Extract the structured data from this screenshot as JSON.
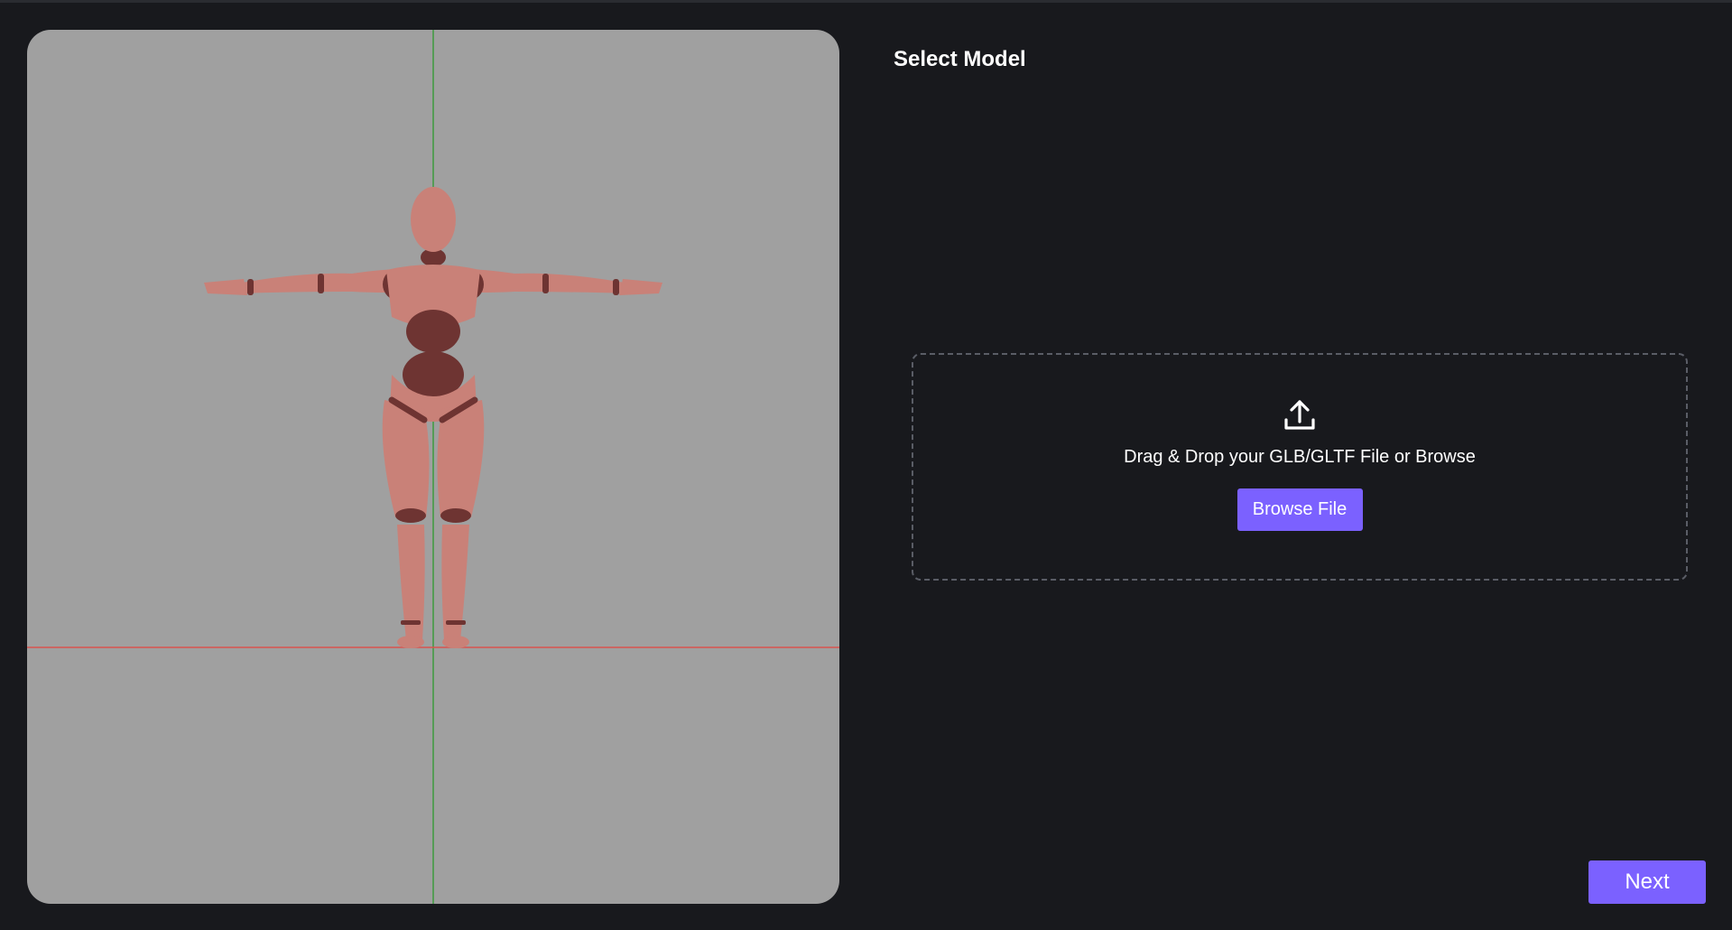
{
  "panel": {
    "title": "Select Model"
  },
  "dropzone": {
    "icon": "upload-icon",
    "text": "Drag & Drop your GLB/GLTF File or Browse",
    "browse_label": "Browse File"
  },
  "footer": {
    "next_label": "Next"
  },
  "colors": {
    "background": "#18191d",
    "viewport_bg": "#a0a0a0",
    "accent": "#7b61ff",
    "axis_x": "#d9534f",
    "axis_y": "#3e9a3e",
    "model_skin": "#c98178",
    "model_joint": "#6e3432"
  }
}
